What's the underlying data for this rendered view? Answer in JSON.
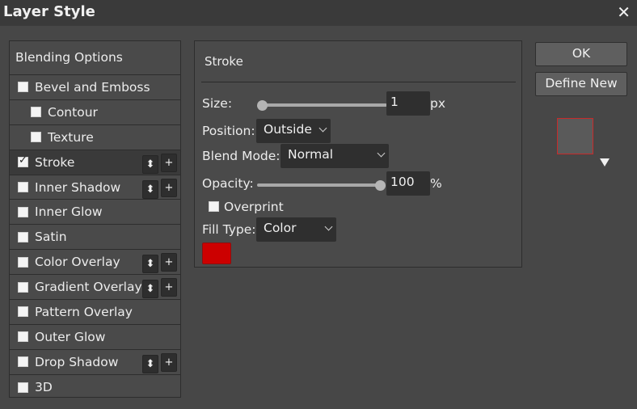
{
  "window": {
    "title": "Layer Style",
    "close": "✕"
  },
  "list": {
    "header": "Blending Options",
    "items": [
      {
        "label": "Bevel and Emboss",
        "checked": false,
        "sub": false,
        "controls": false
      },
      {
        "label": "Contour",
        "checked": false,
        "sub": true,
        "controls": false
      },
      {
        "label": "Texture",
        "checked": false,
        "sub": true,
        "controls": false
      },
      {
        "label": "Stroke",
        "checked": true,
        "sub": false,
        "controls": true,
        "selected": true
      },
      {
        "label": "Inner Shadow",
        "checked": false,
        "sub": false,
        "controls": true
      },
      {
        "label": "Inner Glow",
        "checked": false,
        "sub": false,
        "controls": false
      },
      {
        "label": "Satin",
        "checked": false,
        "sub": false,
        "controls": false
      },
      {
        "label": "Color Overlay",
        "checked": false,
        "sub": false,
        "controls": true
      },
      {
        "label": "Gradient Overlay",
        "checked": false,
        "sub": false,
        "controls": true
      },
      {
        "label": "Pattern Overlay",
        "checked": false,
        "sub": false,
        "controls": false
      },
      {
        "label": "Outer Glow",
        "checked": false,
        "sub": false,
        "controls": false
      },
      {
        "label": "Drop Shadow",
        "checked": false,
        "sub": false,
        "controls": true
      },
      {
        "label": "3D",
        "checked": false,
        "sub": false,
        "controls": false
      }
    ],
    "move_icon": "⬍",
    "add_icon": "+"
  },
  "stroke": {
    "title": "Stroke",
    "size_label": "Size:",
    "size_value": "1",
    "size_unit": "px",
    "size_slider_fraction": 0.0,
    "position_label": "Position:",
    "position_value": "Outside",
    "blend_label": "Blend Mode:",
    "blend_value": "Normal",
    "opacity_label": "Opacity:",
    "opacity_value": "100",
    "opacity_unit": "%",
    "opacity_slider_fraction": 1.0,
    "overprint_label": "Overprint",
    "overprint_checked": false,
    "fill_label": "Fill Type:",
    "fill_value": "Color",
    "fill_color": "#cc0000"
  },
  "buttons": {
    "ok": "OK",
    "define_new": "Define New"
  },
  "preview": {
    "stroke_color": "#c82a2a"
  }
}
